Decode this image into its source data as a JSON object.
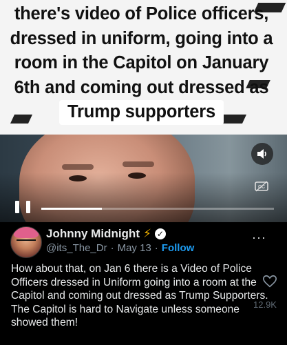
{
  "video": {
    "caption_lines": [
      "there's video of Police officers,",
      "dressed in uniform, going into a",
      "room in the Capitol on January",
      "6th and coming out dressed as",
      "Trump supporters"
    ],
    "progress_fraction": 0.26,
    "icons": {
      "volume": "volume-icon",
      "captions": "closed-captions-icon",
      "pause": "pause-icon"
    }
  },
  "post": {
    "display_name": "Johnny Midnight",
    "name_emoji": "⚡",
    "handle": "@its_The_Dr",
    "separator": "·",
    "date": "May 13",
    "follow_label": "Follow",
    "more_label": "···",
    "text": "How about that, on Jan 6 there is a Video of Police Officers dressed in Uniform going into a room at the Capitol and coming out dressed as Trump Supporters. The Capitol is hard to Navigate unless someone showed them!",
    "like_count": "12.9K"
  },
  "colors": {
    "background": "#000000",
    "accent": "#1d9bf0",
    "text_primary": "#e7e9ea",
    "text_secondary": "#8b98a5"
  }
}
